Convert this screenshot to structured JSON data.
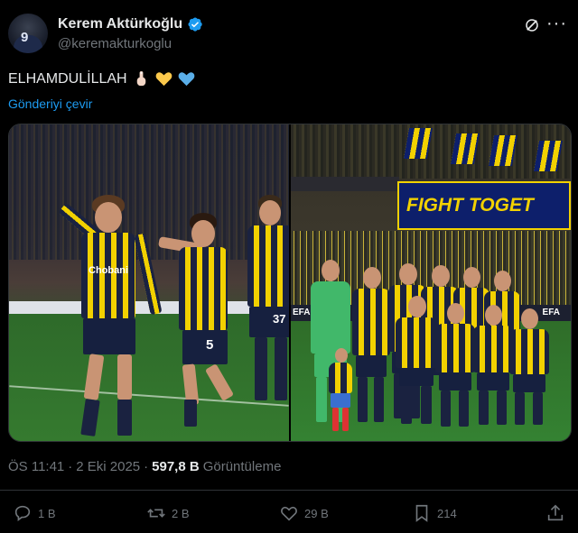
{
  "author": {
    "display_name": "Kerem Aktürkoğlu",
    "handle": "@keremakturkoglu",
    "avatar_number": "9",
    "verified_color": "#1d9bf0"
  },
  "post": {
    "text": "ELHAMDULİLLAH",
    "emojis": [
      "index-pointing-up-emoji",
      "yellow-heart-emoji",
      "blue-heart-emoji"
    ],
    "translate_label": "Gönderiyi çevir"
  },
  "media": {
    "left": {
      "jersey_numbers": [
        "5",
        "37"
      ],
      "sponsor_text": "Chobani"
    },
    "right": {
      "banner_text": "FIGHT TOGET",
      "board_text_left": "EFA",
      "board_text_right": "EFA"
    }
  },
  "meta": {
    "time": "ÖS 11:41",
    "separator": "·",
    "date": "2 Eki 2025",
    "separator2": "·",
    "views_count": "597,8 B",
    "views_label": "Görüntüleme"
  },
  "actions": {
    "replies": "1 B",
    "reposts": "2 B",
    "likes": "29 B",
    "bookmarks": "214"
  },
  "colors": {
    "accent": "#1d9bf0",
    "muted": "#71767b",
    "text": "#e7e9ea",
    "background": "#000000",
    "team_yellow": "#f2d100",
    "team_navy": "#1a2240"
  }
}
